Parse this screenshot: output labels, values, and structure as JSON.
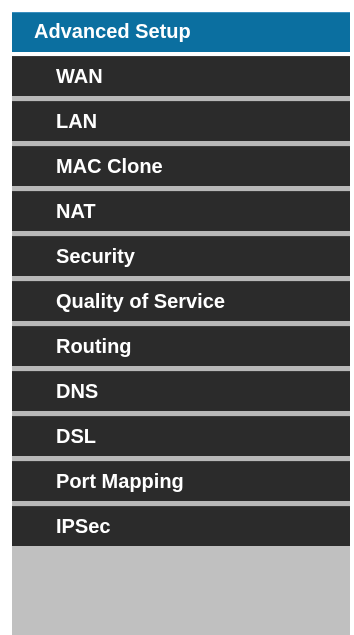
{
  "menu": {
    "header": "Advanced Setup",
    "items": [
      {
        "label": "WAN"
      },
      {
        "label": "LAN"
      },
      {
        "label": "MAC Clone"
      },
      {
        "label": "NAT"
      },
      {
        "label": "Security"
      },
      {
        "label": "Quality of Service"
      },
      {
        "label": "Routing"
      },
      {
        "label": "DNS"
      },
      {
        "label": "DSL"
      },
      {
        "label": "Port Mapping"
      },
      {
        "label": "IPSec"
      }
    ]
  },
  "colors": {
    "header_bg": "#0b6fa0",
    "item_bg": "#2b2b2b",
    "separator": "#b8b8b8",
    "text": "#ffffff"
  }
}
